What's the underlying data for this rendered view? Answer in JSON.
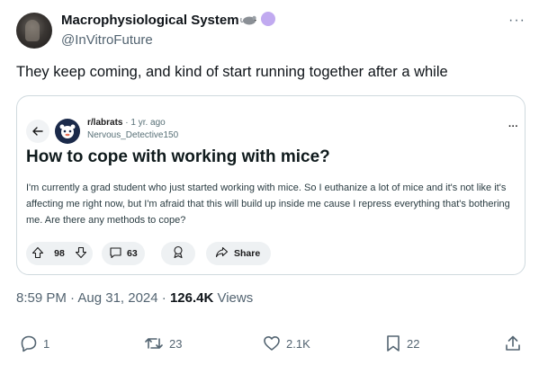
{
  "author": {
    "name": "Macrophysiological System",
    "handle": "@InVitroFuture"
  },
  "icons": {
    "more": "more-icon",
    "mouse_badge": "mouse-icon",
    "circle_badge_color": "#c1aaf0"
  },
  "tweet": {
    "text": "They keep coming, and kind of start running together after a while"
  },
  "embedded_post": {
    "subreddit": "r/labrats",
    "time_ago": "· 1 yr. ago",
    "username": "Nervous_Detective150",
    "title": "How to cope with working with mice?",
    "body": "I'm currently a grad student who just started working with mice. So I euthanize a lot of mice and it's not like it's affecting me right now, but I'm afraid that this will build up inside me cause I repress everything that's bothering me. Are there any methods to cope?",
    "votes": "98",
    "comments": "63",
    "share_label": "Share"
  },
  "meta": {
    "time": "8:59 PM · Aug 31, 2024 · ",
    "views_count": "126.4K",
    "views_label": " Views"
  },
  "actions": {
    "replies": "1",
    "reposts": "23",
    "likes": "2.1K",
    "bookmarks": "22"
  }
}
